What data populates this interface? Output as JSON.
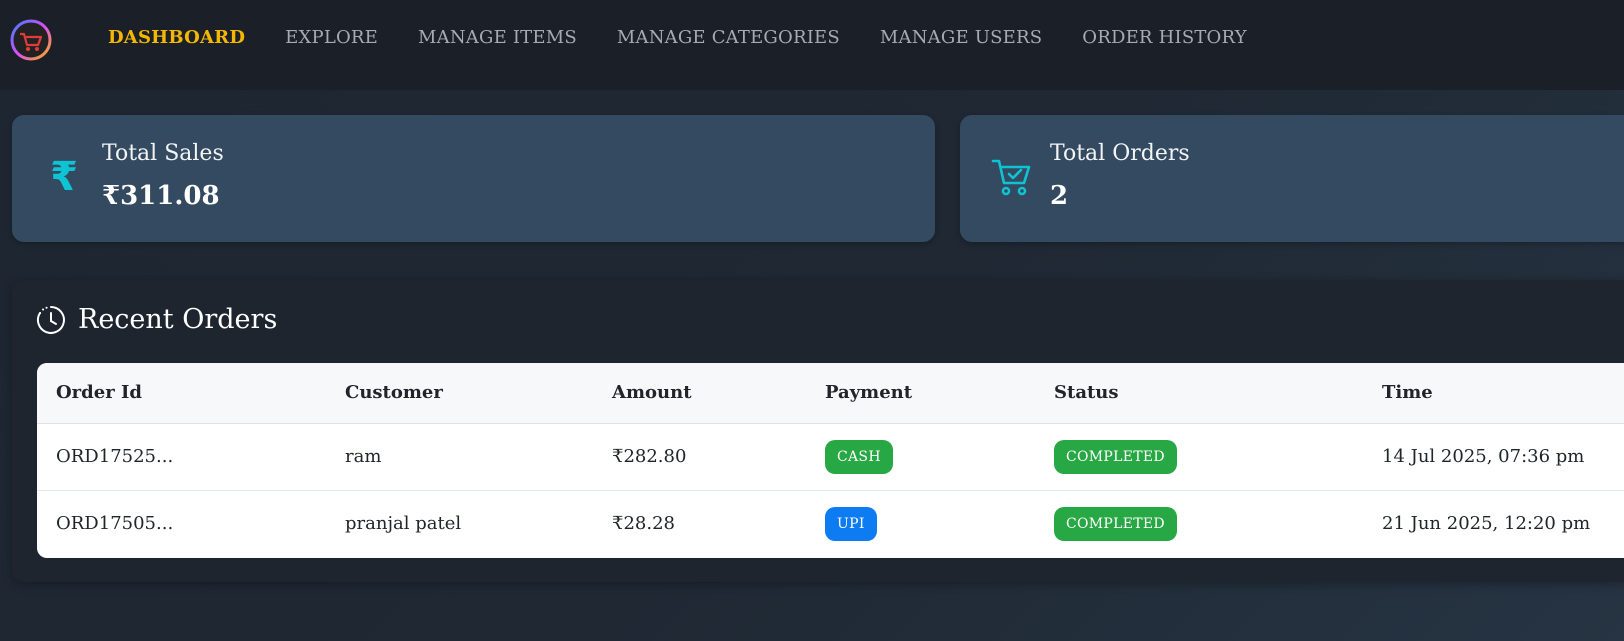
{
  "nav": {
    "items": [
      {
        "label": "DASHBOARD",
        "active": true
      },
      {
        "label": "EXPLORE",
        "active": false
      },
      {
        "label": "MANAGE ITEMS",
        "active": false
      },
      {
        "label": "MANAGE CATEGORIES",
        "active": false
      },
      {
        "label": "MANAGE USERS",
        "active": false
      },
      {
        "label": "ORDER HISTORY",
        "active": false
      }
    ],
    "active_color": "#f5b800"
  },
  "stats": {
    "sales": {
      "label": "Total Sales",
      "value": "₹311.08",
      "icon": "rupee-icon"
    },
    "orders": {
      "label": "Total Orders",
      "value": "2",
      "icon": "cart-check-icon"
    }
  },
  "recent_orders": {
    "title": "Recent Orders",
    "icon": "clock-icon",
    "columns": [
      "Order Id",
      "Customer",
      "Amount",
      "Payment",
      "Status",
      "Time"
    ],
    "rows": [
      {
        "order_id": "ORD17525...",
        "customer": "ram",
        "amount": "₹282.80",
        "payment": "CASH",
        "status": "COMPLETED",
        "time": "14 Jul 2025, 07:36 pm"
      },
      {
        "order_id": "ORD17505...",
        "customer": "pranjal patel",
        "amount": "₹28.28",
        "payment": "UPI",
        "status": "COMPLETED",
        "time": "21 Jun 2025, 12:20 pm"
      }
    ]
  },
  "colors": {
    "accent_cyan": "#0ec4d4",
    "card_bg": "#344a60",
    "success": "#28a745",
    "upi_blue": "#0d7bf2"
  }
}
